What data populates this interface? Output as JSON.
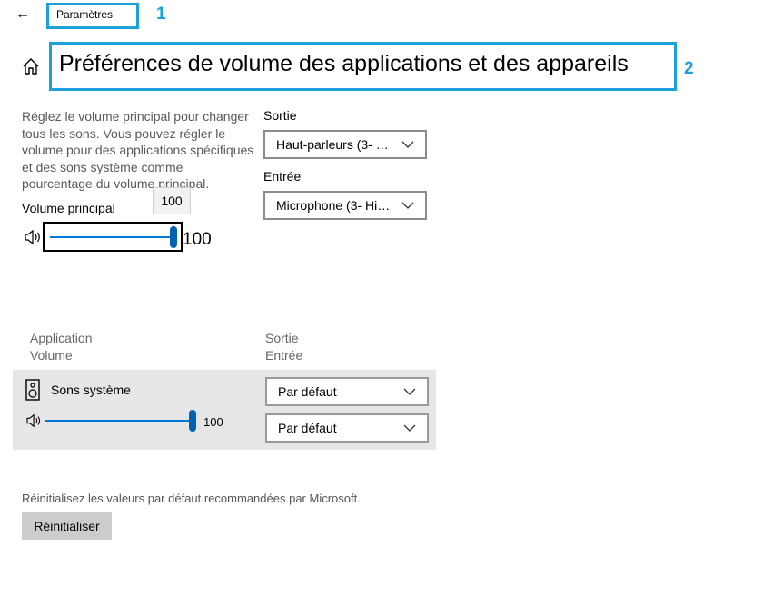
{
  "header": {
    "back_label": "←",
    "app_title": "Paramètres",
    "callout_1": "1"
  },
  "page": {
    "title": "Préférences de volume des applications et des appareils",
    "callout_2": "2",
    "description": "Réglez le volume principal pour changer tous les sons. Vous pouvez régler le volume pour des applications spécifiques et des sons système comme pourcentage du volume principal."
  },
  "master": {
    "label": "Volume principal",
    "tooltip": "100",
    "value": "100",
    "level_percent": 100
  },
  "output": {
    "label": "Sortie",
    "selected": "Haut-parleurs (3- Hi..."
  },
  "input": {
    "label": "Entrée",
    "selected": "Microphone (3- Hig..."
  },
  "apps_table": {
    "col_app": "Application",
    "col_volume": "Volume",
    "col_output": "Sortie",
    "col_input": "Entrée",
    "rows": [
      {
        "name": "Sons système",
        "volume": "100",
        "level_percent": 100,
        "output": "Par défaut",
        "input": "Par défaut"
      }
    ]
  },
  "reset": {
    "text": "Réinitialisez les valeurs par défaut recommandées par Microsoft.",
    "button": "Réinitialiser"
  },
  "colors": {
    "accent": "#0078d7",
    "callout": "#1ea0dc"
  }
}
